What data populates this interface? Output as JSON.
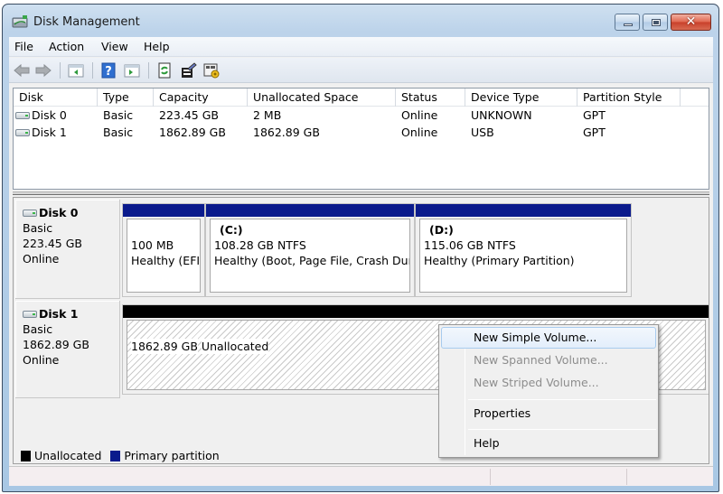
{
  "window": {
    "title": "Disk Management",
    "icon": "disk-management-icon",
    "controls": {
      "minimize": "minimize",
      "maximize": "maximize",
      "close": "✕"
    }
  },
  "menu": [
    "File",
    "Action",
    "View",
    "Help"
  ],
  "toolbar": {
    "buttons": [
      {
        "name": "back",
        "icon": "back-arrow-icon"
      },
      {
        "name": "forward",
        "icon": "forward-arrow-icon"
      },
      {
        "name": "show-hide-console-tree",
        "icon": "console-tree-icon"
      },
      {
        "name": "help",
        "icon": "help-icon",
        "glyph": "?"
      },
      {
        "name": "show-hide-action-pane",
        "icon": "action-pane-icon"
      },
      {
        "name": "refresh",
        "icon": "refresh-icon"
      },
      {
        "name": "properties",
        "icon": "properties-icon"
      },
      {
        "name": "settings",
        "icon": "settings-icon"
      }
    ]
  },
  "list": {
    "columns": [
      "Disk",
      "Type",
      "Capacity",
      "Unallocated Space",
      "Status",
      "Device Type",
      "Partition Style"
    ],
    "rows": [
      {
        "disk": "Disk 0",
        "type": "Basic",
        "capacity": "223.45 GB",
        "unallocated": "2 MB",
        "status": "Online",
        "device_type": "UNKNOWN",
        "partition_style": "GPT"
      },
      {
        "disk": "Disk 1",
        "type": "Basic",
        "capacity": "1862.89 GB",
        "unallocated": "1862.89 GB",
        "status": "Online",
        "device_type": "USB",
        "partition_style": "GPT"
      }
    ]
  },
  "graphical": {
    "disks": [
      {
        "name": "Disk 0",
        "type": "Basic",
        "size": "223.45 GB",
        "status": "Online",
        "partitions": [
          {
            "volume": "",
            "size": "100 MB",
            "status": "Healthy (EFI"
          },
          {
            "volume": "(C:)",
            "size": "108.28 GB NTFS",
            "status": "Healthy (Boot, Page File, Crash Dum"
          },
          {
            "volume": "(D:)",
            "size": "115.06 GB NTFS",
            "status": "Healthy (Primary Partition)"
          }
        ]
      },
      {
        "name": "Disk 1",
        "type": "Basic",
        "size": "1862.89 GB",
        "status": "Online",
        "partitions": [
          {
            "volume": "",
            "size": "1862.89 GB",
            "status": "Unallocated"
          }
        ]
      }
    ],
    "legend": [
      {
        "label": "Unallocated",
        "color": "#000000"
      },
      {
        "label": "Primary partition",
        "color": "#0a1a8c"
      }
    ]
  },
  "context_menu": {
    "items": [
      {
        "label": "New Simple Volume...",
        "enabled": true,
        "highlighted": true
      },
      {
        "label": "New Spanned Volume...",
        "enabled": false
      },
      {
        "label": "New Striped Volume...",
        "enabled": false
      },
      {
        "label": "Properties",
        "enabled": true
      },
      {
        "label": "Help",
        "enabled": true
      }
    ]
  },
  "colors": {
    "primary_partition": "#0a1a8c",
    "unallocated": "#000000"
  }
}
